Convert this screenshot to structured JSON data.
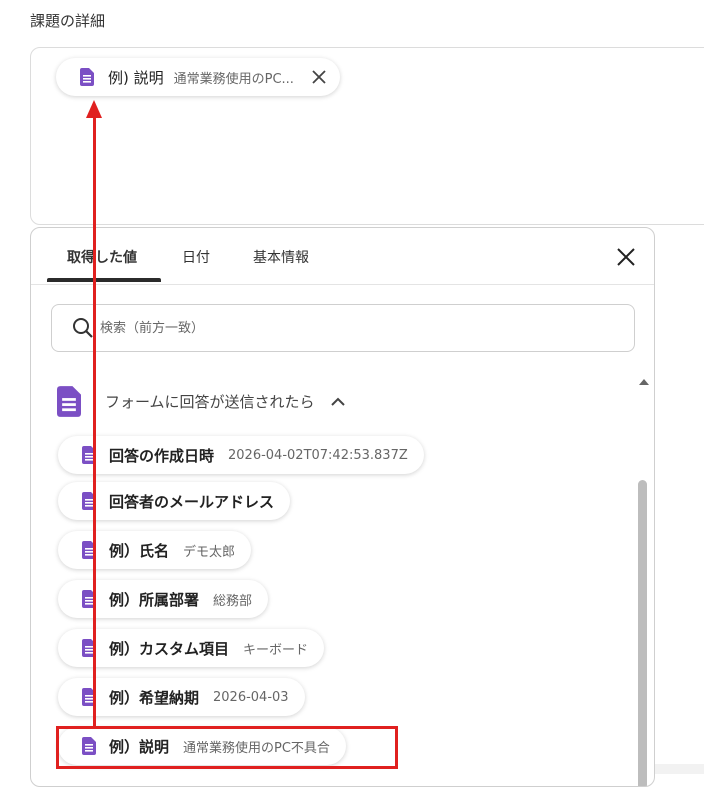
{
  "field_label": "課題の詳細",
  "token": {
    "label": "例) 説明",
    "value": "通常業務使用のPC..."
  },
  "tabs": [
    {
      "label": "取得した値"
    },
    {
      "label": "日付"
    },
    {
      "label": "基本情報"
    }
  ],
  "search": {
    "placeholder": "検索（前方一致）"
  },
  "section": {
    "title": "フォームに回答が送信されたら"
  },
  "items": [
    {
      "label": "回答の作成日時",
      "value": "2026-04-02T07:42:53.837Z"
    },
    {
      "label": "回答者のメールアドレス",
      "value": ""
    },
    {
      "label": "例）氏名",
      "value": "デモ太郎"
    },
    {
      "label": "例）所属部署",
      "value": "総務部"
    },
    {
      "label": "例）カスタム項目",
      "value": "キーボード"
    },
    {
      "label": "例）希望納期",
      "value": "2026-04-03"
    },
    {
      "label": "例）説明",
      "value": "通常業務使用のPC不具合"
    }
  ],
  "colors": {
    "accent": "#7b4fc4",
    "annotation": "#e0201f",
    "active_tab_underline": "#2b2b2b"
  },
  "icons": [
    "doc-icon",
    "close-icon",
    "search-icon",
    "chevron-up-icon",
    "scroll-up-icon"
  ]
}
